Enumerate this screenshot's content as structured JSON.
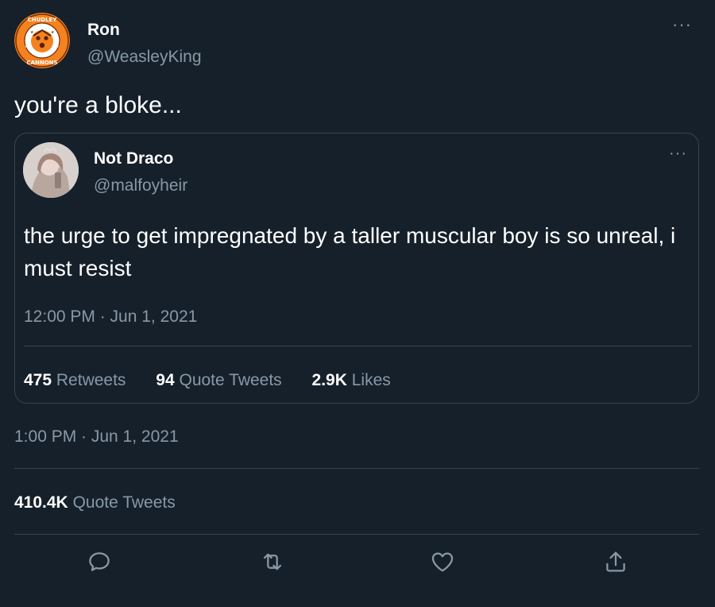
{
  "author": {
    "name": "Ron",
    "handle": "@WeasleyKing",
    "avatar_text_top": "CHUDLEY",
    "avatar_text_bottom": "CANNONS"
  },
  "tweet": {
    "text": "you're a bloke...",
    "timestamp": "1:00 PM · Jun 1, 2021"
  },
  "quoted": {
    "name": "Not Draco",
    "handle": "@malfoyheir",
    "text": "the urge to get impregnated by a taller muscular boy is so unreal, i must resist",
    "timestamp": "12:00 PM · Jun 1, 2021",
    "stats": {
      "retweets_count": "475",
      "retweets_label": "Retweets",
      "quote_count": "94",
      "quote_label": "Quote Tweets",
      "likes_count": "2.9K",
      "likes_label": "Likes"
    }
  },
  "stats": {
    "quote_count": "410.4K",
    "quote_label": "Quote Tweets"
  },
  "ui": {
    "more_glyph": "···"
  },
  "icons": [
    "reply-icon",
    "retweet-icon",
    "like-icon",
    "share-icon"
  ],
  "colors": {
    "background": "#15202b",
    "secondary_text": "#8899a6",
    "border": "#38444d",
    "badge_orange": "#f58220"
  }
}
